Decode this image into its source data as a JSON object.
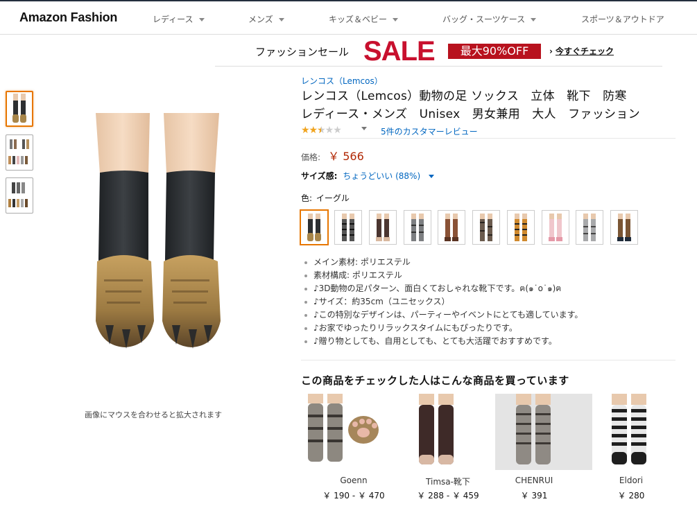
{
  "nav": {
    "logo": "Amazon Fashion",
    "items": [
      "レディース",
      "メンズ",
      "キッズ＆ベビー",
      "バッグ・スーツケース",
      "スポーツ＆アウトドア"
    ]
  },
  "promo": {
    "label": "ファッションセール",
    "sale": "SALE",
    "discount": "最大90%OFF",
    "link": "今すぐチェック"
  },
  "gallery": {
    "zoom_hint": "画像にマウスを合わせると拡大されます"
  },
  "product": {
    "brand": "レンコス（Lemcos）",
    "title_line1": "レンコス（Lemcos）動物の足 ソックス　立体　靴下　防寒",
    "title_line2": "レディース・メンズ　Unisex　男女兼用　大人　ファッション",
    "rating": 2.5,
    "review_count_text": "5件のカスタマーレビュー",
    "price_label": "価格:",
    "price": "￥ 566",
    "size_label": "サイズ感:",
    "size_value": "ちょうどいい (88%)",
    "color_label": "色:",
    "color_value": "イーグル",
    "bullets": [
      "メイン素材: ポリエステル",
      "素材構成: ポリエステル",
      "♪3D動物の足パターン、面白くておしゃれな靴下です。ฅ(๑˙o˙๑)ฅ",
      "♪サイズ：約35cm（ユニセックス）",
      "♪この特別なデザインは、パーティーやイベントにとても適しています。",
      "♪お家でゆったりリラックスタイムにもぴったりです。",
      "♪贈り物としても、自用としても、とても大活躍でおすすめです。"
    ]
  },
  "recommendations": {
    "title": "この商品をチェックした人はこんな商品を買っています",
    "items": [
      {
        "name": "Goenn",
        "price": "￥ 190 - ￥ 470"
      },
      {
        "name": "Timsa-靴下",
        "price": "￥ 288 - ￥ 459"
      },
      {
        "name": "CHENRUI",
        "price": "￥ 391"
      },
      {
        "name": "Eldori",
        "price": "￥ 280"
      }
    ]
  },
  "colors": {
    "price": "#b12704",
    "link": "#0066c0",
    "sale_red": "#c8102e",
    "selected_border": "#e77600",
    "star": "#f0a41f"
  }
}
